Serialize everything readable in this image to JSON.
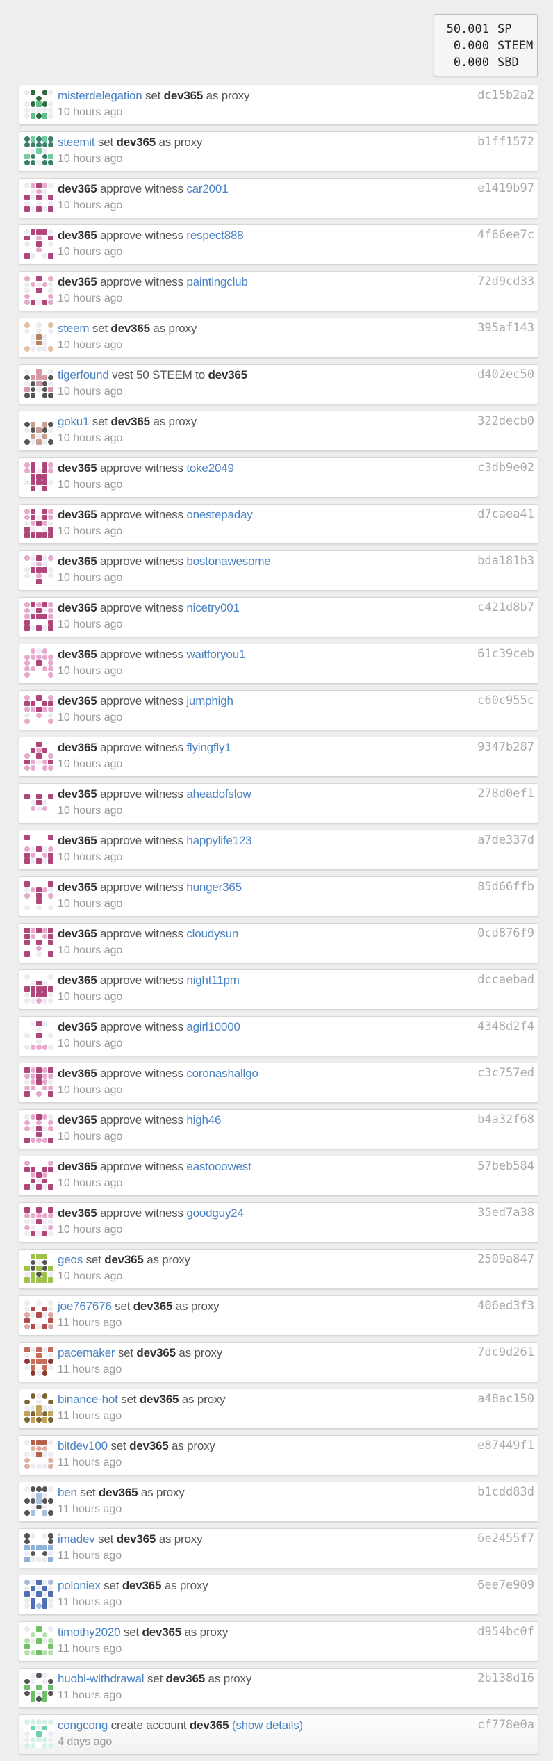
{
  "balance": {
    "rows": [
      {
        "amount": "50.001",
        "unit": "SP"
      },
      {
        "amount": "0.000",
        "unit": "STEEM"
      },
      {
        "amount": "0.000",
        "unit": "SBD"
      }
    ]
  },
  "icons": {
    "avatar": "identicon-avatar"
  },
  "colors": {
    "link": "#4a82c3",
    "text": "#333333",
    "muted": "#9b9b9b",
    "hash": "#aaaaaa",
    "card_border": "#d6d6d6",
    "page_bg": "#eeeeee"
  },
  "operations": [
    {
      "type": "proxy",
      "parts": [
        {
          "t": "misterdelegation",
          "s": "link"
        },
        {
          "t": " set ",
          "s": "verb"
        },
        {
          "t": "dev365",
          "s": "bold"
        },
        {
          "t": " as proxy",
          "s": "verb"
        }
      ],
      "time": "10 hours ago",
      "hash": "dc15b2a2",
      "avatar_color": "#5fbf86",
      "avatar_alt": "#2d6b3f"
    },
    {
      "type": "proxy",
      "parts": [
        {
          "t": "steemit",
          "s": "link"
        },
        {
          "t": " set ",
          "s": "verb"
        },
        {
          "t": "dev365",
          "s": "bold"
        },
        {
          "t": " as proxy",
          "s": "verb"
        }
      ],
      "time": "10 hours ago",
      "hash": "b1ff1572",
      "avatar_color": "#6fcfa0",
      "avatar_alt": "#3a7f6a"
    },
    {
      "type": "witness",
      "parts": [
        {
          "t": "dev365",
          "s": "bold"
        },
        {
          "t": " approve witness ",
          "s": "verb"
        },
        {
          "t": "car2001",
          "s": "link"
        }
      ],
      "time": "10 hours ago",
      "hash": "e1419b97",
      "avatar_color": "#b0457c",
      "avatar_alt": "#e7a9cc"
    },
    {
      "type": "witness",
      "parts": [
        {
          "t": "dev365",
          "s": "bold"
        },
        {
          "t": " approve witness ",
          "s": "verb"
        },
        {
          "t": "respect888",
          "s": "link"
        }
      ],
      "time": "10 hours ago",
      "hash": "4f66ee7c",
      "avatar_color": "#b0457c",
      "avatar_alt": "#e7a9cc"
    },
    {
      "type": "witness",
      "parts": [
        {
          "t": "dev365",
          "s": "bold"
        },
        {
          "t": " approve witness ",
          "s": "verb"
        },
        {
          "t": "paintingclub",
          "s": "link"
        }
      ],
      "time": "10 hours ago",
      "hash": "72d9cd33",
      "avatar_color": "#b0457c",
      "avatar_alt": "#e7a9cc"
    },
    {
      "type": "proxy",
      "parts": [
        {
          "t": "steem",
          "s": "link"
        },
        {
          "t": " set ",
          "s": "verb"
        },
        {
          "t": "dev365",
          "s": "bold"
        },
        {
          "t": " as proxy",
          "s": "verb"
        }
      ],
      "time": "10 hours ago",
      "hash": "395af143",
      "avatar_color": "#b5845e",
      "avatar_alt": "#e2c2a5"
    },
    {
      "type": "vest",
      "parts": [
        {
          "t": "tigerfound",
          "s": "link"
        },
        {
          "t": " vest 50 STEEM to ",
          "s": "verb"
        },
        {
          "t": "dev365",
          "s": "bold"
        }
      ],
      "time": "10 hours ago",
      "hash": "d402ec50",
      "avatar_color": "#d49aa4",
      "avatar_alt": "#555555"
    },
    {
      "type": "proxy",
      "parts": [
        {
          "t": "goku1",
          "s": "link"
        },
        {
          "t": " set ",
          "s": "verb"
        },
        {
          "t": "dev365",
          "s": "bold"
        },
        {
          "t": " as proxy",
          "s": "verb"
        }
      ],
      "time": "10 hours ago",
      "hash": "322decb0",
      "avatar_color": "#c9a08f",
      "avatar_alt": "#555555"
    },
    {
      "type": "witness",
      "parts": [
        {
          "t": "dev365",
          "s": "bold"
        },
        {
          "t": " approve witness ",
          "s": "verb"
        },
        {
          "t": "toke2049",
          "s": "link"
        }
      ],
      "time": "10 hours ago",
      "hash": "c3db9e02",
      "avatar_color": "#b0457c",
      "avatar_alt": "#e7a9cc"
    },
    {
      "type": "witness",
      "parts": [
        {
          "t": "dev365",
          "s": "bold"
        },
        {
          "t": " approve witness ",
          "s": "verb"
        },
        {
          "t": "onestepaday",
          "s": "link"
        }
      ],
      "time": "10 hours ago",
      "hash": "d7caea41",
      "avatar_color": "#b0457c",
      "avatar_alt": "#e7a9cc"
    },
    {
      "type": "witness",
      "parts": [
        {
          "t": "dev365",
          "s": "bold"
        },
        {
          "t": " approve witness ",
          "s": "verb"
        },
        {
          "t": "bostonawesome",
          "s": "link"
        }
      ],
      "time": "10 hours ago",
      "hash": "bda181b3",
      "avatar_color": "#b0457c",
      "avatar_alt": "#e7a9cc"
    },
    {
      "type": "witness",
      "parts": [
        {
          "t": "dev365",
          "s": "bold"
        },
        {
          "t": " approve witness ",
          "s": "verb"
        },
        {
          "t": "nicetry001",
          "s": "link"
        }
      ],
      "time": "10 hours ago",
      "hash": "c421d8b7",
      "avatar_color": "#b0457c",
      "avatar_alt": "#e7a9cc"
    },
    {
      "type": "witness",
      "parts": [
        {
          "t": "dev365",
          "s": "bold"
        },
        {
          "t": " approve witness ",
          "s": "verb"
        },
        {
          "t": "waitforyou1",
          "s": "link"
        }
      ],
      "time": "10 hours ago",
      "hash": "61c39ceb",
      "avatar_color": "#b0457c",
      "avatar_alt": "#e7a9cc"
    },
    {
      "type": "witness",
      "parts": [
        {
          "t": "dev365",
          "s": "bold"
        },
        {
          "t": " approve witness ",
          "s": "verb"
        },
        {
          "t": "jumphigh",
          "s": "link"
        }
      ],
      "time": "10 hours ago",
      "hash": "c60c955c",
      "avatar_color": "#b0457c",
      "avatar_alt": "#e7a9cc"
    },
    {
      "type": "witness",
      "parts": [
        {
          "t": "dev365",
          "s": "bold"
        },
        {
          "t": " approve witness ",
          "s": "verb"
        },
        {
          "t": "flyingfly1",
          "s": "link"
        }
      ],
      "time": "10 hours ago",
      "hash": "9347b287",
      "avatar_color": "#b0457c",
      "avatar_alt": "#e7a9cc"
    },
    {
      "type": "witness",
      "parts": [
        {
          "t": "dev365",
          "s": "bold"
        },
        {
          "t": " approve witness ",
          "s": "verb"
        },
        {
          "t": "aheadofslow",
          "s": "link"
        }
      ],
      "time": "10 hours ago",
      "hash": "278d0ef1",
      "avatar_color": "#b0457c",
      "avatar_alt": "#e7a9cc"
    },
    {
      "type": "witness",
      "parts": [
        {
          "t": "dev365",
          "s": "bold"
        },
        {
          "t": " approve witness ",
          "s": "verb"
        },
        {
          "t": "happylife123",
          "s": "link"
        }
      ],
      "time": "10 hours ago",
      "hash": "a7de337d",
      "avatar_color": "#b0457c",
      "avatar_alt": "#e7a9cc"
    },
    {
      "type": "witness",
      "parts": [
        {
          "t": "dev365",
          "s": "bold"
        },
        {
          "t": " approve witness ",
          "s": "verb"
        },
        {
          "t": "hunger365",
          "s": "link"
        }
      ],
      "time": "10 hours ago",
      "hash": "85d66ffb",
      "avatar_color": "#b0457c",
      "avatar_alt": "#e7a9cc"
    },
    {
      "type": "witness",
      "parts": [
        {
          "t": "dev365",
          "s": "bold"
        },
        {
          "t": " approve witness ",
          "s": "verb"
        },
        {
          "t": "cloudysun",
          "s": "link"
        }
      ],
      "time": "10 hours ago",
      "hash": "0cd876f9",
      "avatar_color": "#b0457c",
      "avatar_alt": "#e7a9cc"
    },
    {
      "type": "witness",
      "parts": [
        {
          "t": "dev365",
          "s": "bold"
        },
        {
          "t": " approve witness ",
          "s": "verb"
        },
        {
          "t": "night11pm",
          "s": "link"
        }
      ],
      "time": "10 hours ago",
      "hash": "dccaebad",
      "avatar_color": "#b0457c",
      "avatar_alt": "#e7a9cc"
    },
    {
      "type": "witness",
      "parts": [
        {
          "t": "dev365",
          "s": "bold"
        },
        {
          "t": " approve witness ",
          "s": "verb"
        },
        {
          "t": "agirl10000",
          "s": "link"
        }
      ],
      "time": "10 hours ago",
      "hash": "4348d2f4",
      "avatar_color": "#b0457c",
      "avatar_alt": "#e7a9cc"
    },
    {
      "type": "witness",
      "parts": [
        {
          "t": "dev365",
          "s": "bold"
        },
        {
          "t": " approve witness ",
          "s": "verb"
        },
        {
          "t": "coronashallgo",
          "s": "link"
        }
      ],
      "time": "10 hours ago",
      "hash": "c3c757ed",
      "avatar_color": "#b0457c",
      "avatar_alt": "#e7a9cc"
    },
    {
      "type": "witness",
      "parts": [
        {
          "t": "dev365",
          "s": "bold"
        },
        {
          "t": " approve witness ",
          "s": "verb"
        },
        {
          "t": "high46",
          "s": "link"
        }
      ],
      "time": "10 hours ago",
      "hash": "b4a32f68",
      "avatar_color": "#b0457c",
      "avatar_alt": "#e7a9cc"
    },
    {
      "type": "witness",
      "parts": [
        {
          "t": "dev365",
          "s": "bold"
        },
        {
          "t": " approve witness ",
          "s": "verb"
        },
        {
          "t": "eastooowest",
          "s": "link"
        }
      ],
      "time": "10 hours ago",
      "hash": "57beb584",
      "avatar_color": "#b0457c",
      "avatar_alt": "#e7a9cc"
    },
    {
      "type": "witness",
      "parts": [
        {
          "t": "dev365",
          "s": "bold"
        },
        {
          "t": " approve witness ",
          "s": "verb"
        },
        {
          "t": "goodguy24",
          "s": "link"
        }
      ],
      "time": "10 hours ago",
      "hash": "35ed7a38",
      "avatar_color": "#b0457c",
      "avatar_alt": "#e7a9cc"
    },
    {
      "type": "proxy",
      "parts": [
        {
          "t": "geos",
          "s": "link"
        },
        {
          "t": " set ",
          "s": "verb"
        },
        {
          "t": "dev365",
          "s": "bold"
        },
        {
          "t": " as proxy",
          "s": "verb"
        }
      ],
      "time": "10 hours ago",
      "hash": "2509a847",
      "avatar_color": "#9fc24a",
      "avatar_alt": "#555555"
    },
    {
      "type": "proxy",
      "parts": [
        {
          "t": "joe767676",
          "s": "link"
        },
        {
          "t": " set ",
          "s": "verb"
        },
        {
          "t": "dev365",
          "s": "bold"
        },
        {
          "t": " as proxy",
          "s": "verb"
        }
      ],
      "time": "11 hours ago",
      "hash": "406ed3f3",
      "avatar_color": "#b24a4a",
      "avatar_alt": "#e0a7a7"
    },
    {
      "type": "proxy",
      "parts": [
        {
          "t": "pacemaker",
          "s": "link"
        },
        {
          "t": " set ",
          "s": "verb"
        },
        {
          "t": "dev365",
          "s": "bold"
        },
        {
          "t": " as proxy",
          "s": "verb"
        }
      ],
      "time": "11 hours ago",
      "hash": "7dc9d261",
      "avatar_color": "#c56b5a",
      "avatar_alt": "#8a3a2d"
    },
    {
      "type": "proxy",
      "parts": [
        {
          "t": "binance-hot",
          "s": "link"
        },
        {
          "t": " set ",
          "s": "verb"
        },
        {
          "t": "dev365",
          "s": "bold"
        },
        {
          "t": " as proxy",
          "s": "verb"
        }
      ],
      "time": "11 hours ago",
      "hash": "a48ac150",
      "avatar_color": "#c6a35a",
      "avatar_alt": "#7d6533"
    },
    {
      "type": "proxy",
      "parts": [
        {
          "t": "bitdev100",
          "s": "link"
        },
        {
          "t": " set ",
          "s": "verb"
        },
        {
          "t": "dev365",
          "s": "bold"
        },
        {
          "t": " as proxy",
          "s": "verb"
        }
      ],
      "time": "11 hours ago",
      "hash": "e87449f1",
      "avatar_color": "#b5614a",
      "avatar_alt": "#e0b09f"
    },
    {
      "type": "proxy",
      "parts": [
        {
          "t": "ben",
          "s": "link"
        },
        {
          "t": " set ",
          "s": "verb"
        },
        {
          "t": "dev365",
          "s": "bold"
        },
        {
          "t": " as proxy",
          "s": "verb"
        }
      ],
      "time": "11 hours ago",
      "hash": "b1cdd83d",
      "avatar_color": "#a9bfe0",
      "avatar_alt": "#555555"
    },
    {
      "type": "proxy",
      "parts": [
        {
          "t": "imadev",
          "s": "link"
        },
        {
          "t": " set ",
          "s": "verb"
        },
        {
          "t": "dev365",
          "s": "bold"
        },
        {
          "t": " as proxy",
          "s": "verb"
        }
      ],
      "time": "11 hours ago",
      "hash": "6e2455f7",
      "avatar_color": "#8fb2d9",
      "avatar_alt": "#555555"
    },
    {
      "type": "proxy",
      "parts": [
        {
          "t": "poloniex",
          "s": "link"
        },
        {
          "t": " set ",
          "s": "verb"
        },
        {
          "t": "dev365",
          "s": "bold"
        },
        {
          "t": " as proxy",
          "s": "verb"
        }
      ],
      "time": "11 hours ago",
      "hash": "6ee7e909",
      "avatar_color": "#4f6fb5",
      "avatar_alt": "#a9b9e0"
    },
    {
      "type": "proxy",
      "parts": [
        {
          "t": "timothy2020",
          "s": "link"
        },
        {
          "t": " set ",
          "s": "verb"
        },
        {
          "t": "dev365",
          "s": "bold"
        },
        {
          "t": " as proxy",
          "s": "verb"
        }
      ],
      "time": "11 hours ago",
      "hash": "d954bc0f",
      "avatar_color": "#72c15e",
      "avatar_alt": "#b8e0ad"
    },
    {
      "type": "proxy",
      "parts": [
        {
          "t": "huobi-withdrawal",
          "s": "link"
        },
        {
          "t": " set ",
          "s": "verb"
        },
        {
          "t": "dev365",
          "s": "bold"
        },
        {
          "t": " as proxy",
          "s": "verb"
        }
      ],
      "time": "11 hours ago",
      "hash": "2b138d16",
      "avatar_color": "#6fbf6a",
      "avatar_alt": "#555555"
    },
    {
      "type": "create",
      "parts": [
        {
          "t": "congcong",
          "s": "link"
        },
        {
          "t": " create account ",
          "s": "verb"
        },
        {
          "t": "dev365",
          "s": "bold"
        },
        {
          "t": " ",
          "s": "verb"
        },
        {
          "t": "(show details)",
          "s": "link"
        }
      ],
      "time": "4 days ago",
      "hash": "cf778e0a",
      "avatar_color": "#6fcfb0",
      "avatar_alt": "#d6f0e6"
    }
  ]
}
